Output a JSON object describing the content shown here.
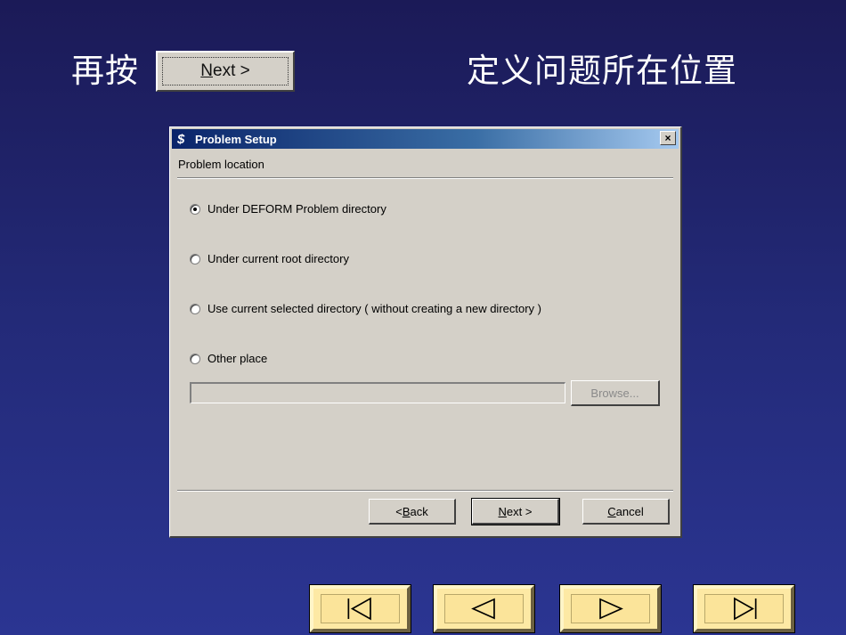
{
  "slide": {
    "heading_left": "再按",
    "heading_right": "定义问题所在位置",
    "inline_next": {
      "label_underlined": "N",
      "label_rest": "ext >"
    }
  },
  "dialog": {
    "title": "Problem Setup",
    "close_glyph": "×",
    "section_label": "Problem location",
    "options": [
      {
        "label": "Under DEFORM Problem directory",
        "checked": true
      },
      {
        "label": "Under current root directory",
        "checked": false
      },
      {
        "label": "Use current selected directory ( without creating a new directory )",
        "checked": false
      },
      {
        "label": "Other place",
        "checked": false
      }
    ],
    "path_value": "",
    "browse_label": "Browse...",
    "buttons": {
      "back": {
        "prefix": "< ",
        "underlined": "B",
        "rest": "ack"
      },
      "next": {
        "underlined": "N",
        "rest": "ext >"
      },
      "cancel": {
        "underlined": "C",
        "rest": "ancel"
      }
    }
  },
  "nav_icons": [
    "first-slide-icon",
    "previous-slide-icon",
    "next-slide-icon",
    "last-slide-icon"
  ]
}
